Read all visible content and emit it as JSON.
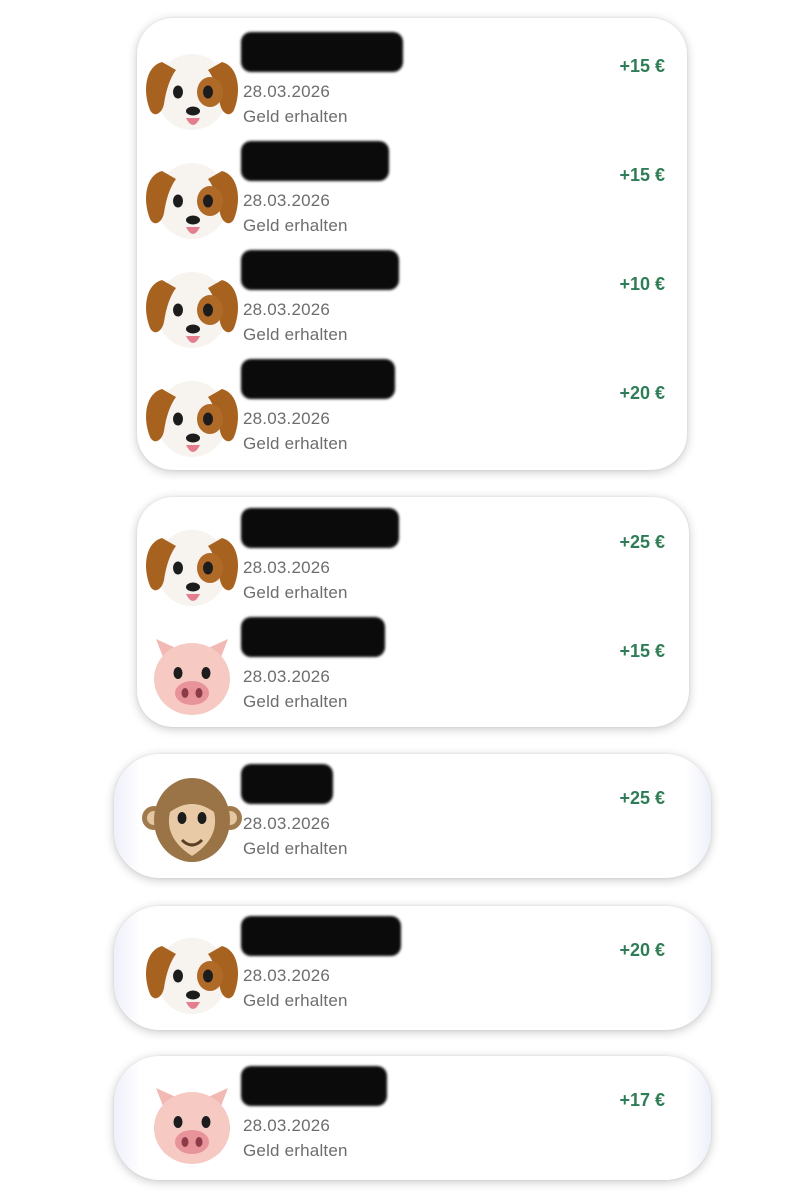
{
  "colors": {
    "amount_positive": "#2e7d57",
    "secondary_text": "#6d6d6d",
    "card_background": "#ffffff"
  },
  "cards": [
    {
      "transactions": [
        {
          "avatar": "dog-emoji-icon",
          "name": "",
          "date": "28.03.2026",
          "status": "Geld erhalten",
          "amount": "+15 €"
        },
        {
          "avatar": "dog-emoji-icon",
          "name": "",
          "date": "28.03.2026",
          "status": "Geld erhalten",
          "amount": "+15 €"
        },
        {
          "avatar": "dog-emoji-icon",
          "name": "",
          "date": "28.03.2026",
          "status": "Geld erhalten",
          "amount": "+10 €"
        },
        {
          "avatar": "dog-emoji-icon",
          "name": "",
          "date": "28.03.2026",
          "status": "Geld erhalten",
          "amount": "+20 €"
        }
      ]
    },
    {
      "transactions": [
        {
          "avatar": "dog-emoji-icon",
          "name": "",
          "date": "28.03.2026",
          "status": "Geld erhalten",
          "amount": "+25 €"
        },
        {
          "avatar": "pig-emoji-icon",
          "name": "",
          "date": "28.03.2026",
          "status": "Geld erhalten",
          "amount": "+15 €"
        }
      ]
    },
    {
      "transactions": [
        {
          "avatar": "monkey-emoji-icon",
          "name": "",
          "date": "28.03.2026",
          "status": "Geld erhalten",
          "amount": "+25 €"
        }
      ]
    },
    {
      "transactions": [
        {
          "avatar": "dog-emoji-icon",
          "name": "",
          "date": "28.03.2026",
          "status": "Geld erhalten",
          "amount": "+20 €"
        }
      ]
    },
    {
      "transactions": [
        {
          "avatar": "pig-emoji-icon",
          "name": "",
          "date": "28.03.2026",
          "status": "Geld erhalten",
          "amount": "+17 €"
        }
      ]
    }
  ]
}
